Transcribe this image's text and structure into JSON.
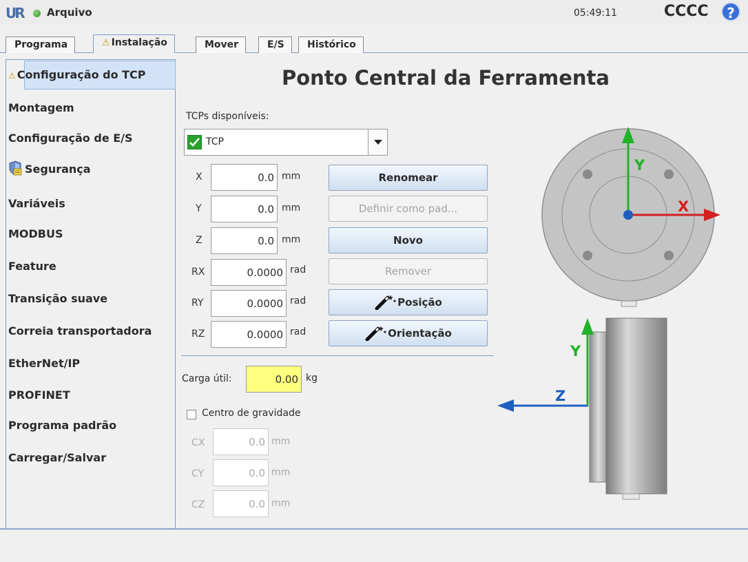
{
  "header": {
    "file_label": "Arquivo",
    "clock": "05:49:11",
    "robot_name": "CCCC",
    "help_symbol": "?",
    "logo_text": "UR"
  },
  "tabs": [
    {
      "label": "Programa"
    },
    {
      "label": "Instalação",
      "active": true,
      "warning": true
    },
    {
      "label": "Mover"
    },
    {
      "label": "E/S"
    },
    {
      "label": "Histórico"
    }
  ],
  "sidebar": {
    "items": [
      {
        "label": "Configuração do TCP",
        "selected": true,
        "warning": true
      },
      {
        "label": "Montagem"
      },
      {
        "label": "Configuração de E/S"
      },
      {
        "label": "Segurança",
        "icon": "shield-icon"
      },
      {
        "label": "Variáveis"
      },
      {
        "label": "MODBUS"
      },
      {
        "label": "Feature"
      },
      {
        "label": "Transição suave"
      },
      {
        "label": "Correia transportadora"
      },
      {
        "label": "EtherNet/IP"
      },
      {
        "label": "PROFINET"
      },
      {
        "label": "Programa padrão"
      },
      {
        "label": "Carregar/Salvar"
      }
    ]
  },
  "main": {
    "title": "Ponto Central da Ferramenta",
    "tcps_label": "TCPs disponíveis:",
    "tcp_selected": "TCP",
    "coords": [
      {
        "label": "X",
        "value": "0.0",
        "unit": "mm"
      },
      {
        "label": "Y",
        "value": "0.0",
        "unit": "mm"
      },
      {
        "label": "Z",
        "value": "0.0",
        "unit": "mm"
      },
      {
        "label": "RX",
        "value": "0.0000",
        "unit": "rad"
      },
      {
        "label": "RY",
        "value": "0.0000",
        "unit": "rad"
      },
      {
        "label": "RZ",
        "value": "0.0000",
        "unit": "rad"
      }
    ],
    "buttons": {
      "rename": "Renomear",
      "set_default": "Definir como pad...",
      "new": "Novo",
      "remove": "Remover",
      "position": "Posição",
      "orientation": "Orientação"
    },
    "payload_label": "Carga útil:",
    "payload_value": "0.00",
    "payload_unit": "kg",
    "cog_label": "Centro de gravidade",
    "cog": [
      {
        "label": "CX",
        "value": "0.0",
        "unit": "mm"
      },
      {
        "label": "CY",
        "value": "0.0",
        "unit": "mm"
      },
      {
        "label": "CZ",
        "value": "0.0",
        "unit": "mm"
      }
    ]
  },
  "diagram": {
    "axis_x": "X",
    "axis_y": "Y",
    "axis_y_side": "Y",
    "axis_z": "Z",
    "colors": {
      "x": "#d42020",
      "y": "#22b22a",
      "z": "#1f5fbf"
    }
  }
}
